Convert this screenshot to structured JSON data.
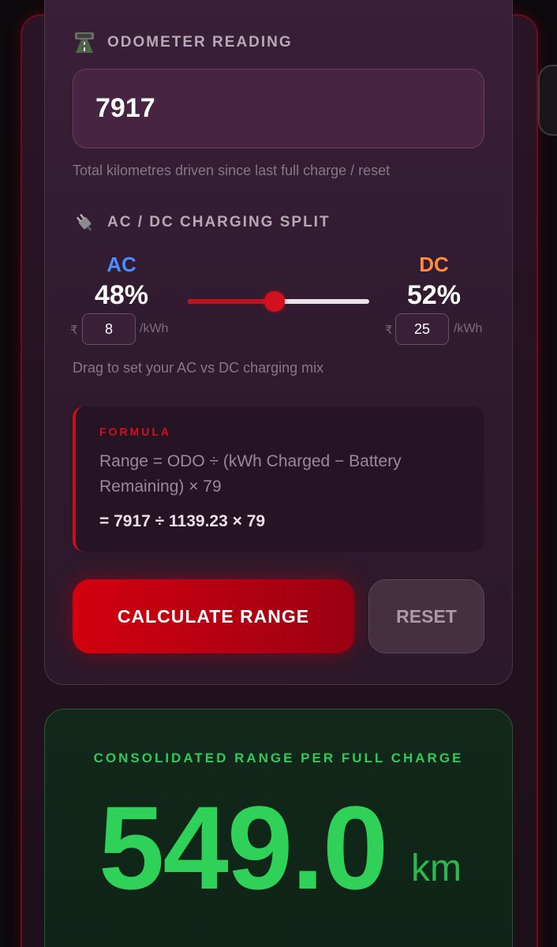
{
  "odometer": {
    "label": "ODOMETER READING",
    "icon": "road-icon",
    "value": "7917",
    "hint": "Total kilometres driven since last full charge / reset"
  },
  "charging": {
    "label": "AC / DC CHARGING SPLIT",
    "icon": "plug-icon",
    "ac": {
      "name": "AC",
      "percent": "48%",
      "currency": "₹",
      "price": "8",
      "unit": "/kWh",
      "color": "#4a8dff"
    },
    "dc": {
      "name": "DC",
      "percent": "52%",
      "currency": "₹",
      "price": "25",
      "unit": "/kWh",
      "color": "#ff8a3d"
    },
    "split_fraction": 0.48,
    "hint": "Drag to set your AC vs DC charging mix"
  },
  "formula": {
    "title": "FORMULA",
    "text": "Range = ODO ÷ (kWh Charged − Battery Remaining) × 79",
    "calculation": "= 7917 ÷ 1139.23 × 79"
  },
  "actions": {
    "calculate_label": "CALCULATE RANGE",
    "reset_label": "RESET"
  },
  "result": {
    "label": "CONSOLIDATED RANGE PER FULL CHARGE",
    "value": "549.0",
    "unit": "km"
  },
  "colors": {
    "accent_red": "#d3101e",
    "result_green": "#30d158"
  }
}
